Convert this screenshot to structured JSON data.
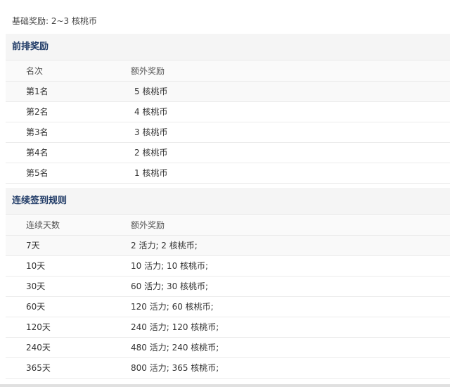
{
  "base_reward": {
    "label": "基础奖励: 2~3 核桃币"
  },
  "top_rank": {
    "title": "前排奖励",
    "headers": [
      "名次",
      "额外奖励"
    ],
    "rows": [
      [
        "第1名",
        "5 核桃币"
      ],
      [
        "第2名",
        "4 核桃币"
      ],
      [
        "第3名",
        "3 核桃币"
      ],
      [
        "第4名",
        "2 核桃币"
      ],
      [
        "第5名",
        "1 核桃币"
      ]
    ]
  },
  "streak": {
    "title": "连续签到规则",
    "headers": [
      "连续天数",
      "额外奖励"
    ],
    "rows": [
      [
        "7天",
        "2 活力; 2 核桃币;"
      ],
      [
        "10天",
        "10 活力; 10 核桃币;"
      ],
      [
        "30天",
        "60 活力; 30 核桃币;"
      ],
      [
        "60天",
        "120 活力; 60 核桃币;"
      ],
      [
        "120天",
        "240 活力; 120 核桃币;"
      ],
      [
        "240天",
        "480 活力; 240 核桃币;"
      ],
      [
        "365天",
        "800 活力; 365 核桃币;"
      ]
    ]
  },
  "colors": {
    "heading": "#1f3a66",
    "text": "#333333",
    "header_bg": "#f5f5f5"
  }
}
